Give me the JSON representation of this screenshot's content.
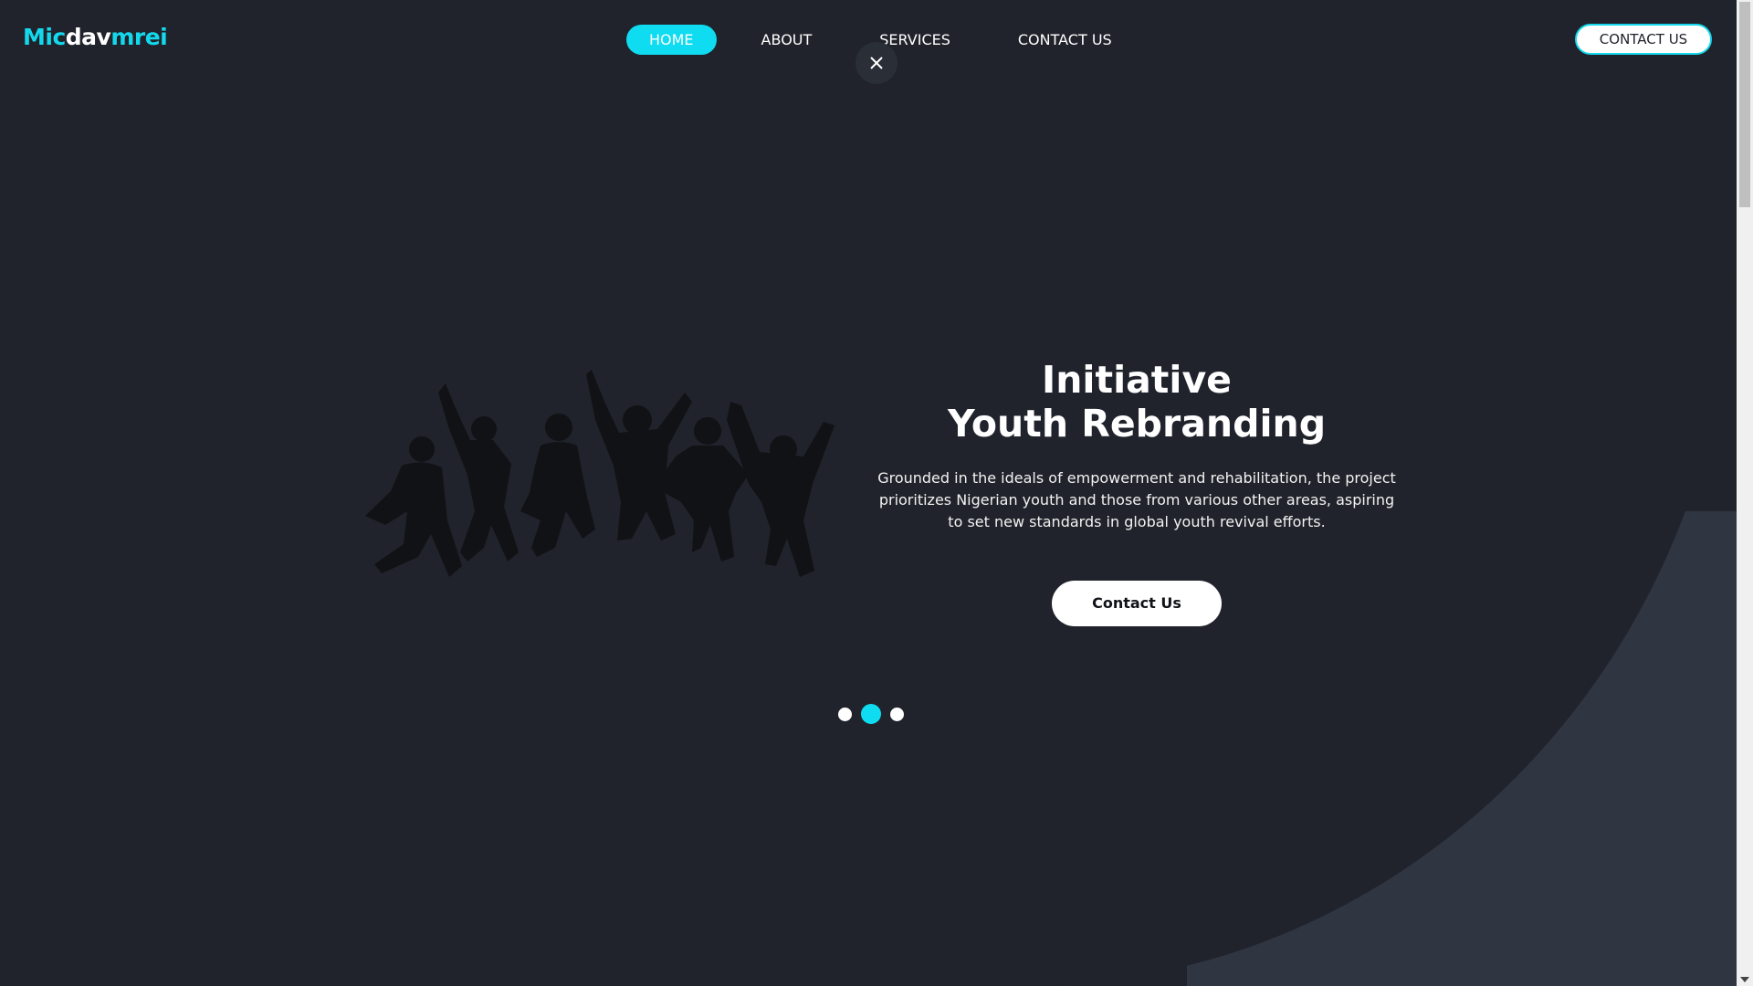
{
  "brand": {
    "part1": "Mic",
    "part2": "dav",
    "part3": "mrei",
    "accent_color": "#14d8ec"
  },
  "nav": {
    "items": [
      {
        "label": "HOME",
        "active": true
      },
      {
        "label": "ABOUT",
        "active": false
      },
      {
        "label": "SERVICES",
        "active": false
      },
      {
        "label": "CONTACT US",
        "active": false
      }
    ]
  },
  "header_cta": {
    "label": "CONTACT US"
  },
  "close_icon": "close-icon",
  "hero": {
    "title_line1": "Initiative",
    "title_line2": "Youth Rebranding",
    "description": "Grounded in the ideals of empowerment and rehabilitation, the project prioritizes Nigerian youth and those from various other areas, aspiring to set new standards in global youth revival efforts.",
    "button_label": "Contact Us",
    "image": "jumping-youth-silhouettes"
  },
  "carousel": {
    "slide_count": 3,
    "active_index": 1
  },
  "colors": {
    "background": "#20232b",
    "curve_shade": "#303542",
    "accent": "#0fdcf0"
  }
}
